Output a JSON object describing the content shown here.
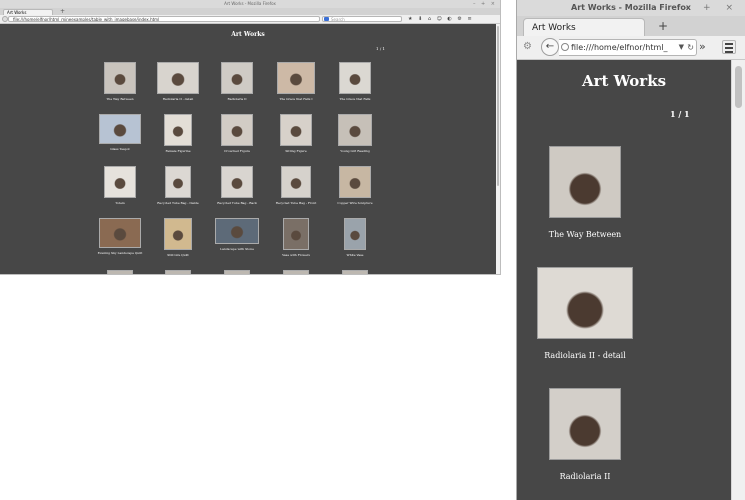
{
  "left_browser": {
    "title": "Art Works - Mozilla Firefox",
    "tab_label": "Art Works",
    "url": "file:///home/elfnor/html_mineexamples/table_with_imagebase/index.html",
    "search_placeholder": "Search",
    "page_title": "Art Works",
    "page_count": "1 / 1",
    "gallery": [
      {
        "caption": "The Way Between",
        "tone": "#c9c4bd"
      },
      {
        "caption": "Radiolaria II - detail",
        "tone": "#d8d4ce"
      },
      {
        "caption": "Radiolaria II",
        "tone": "#cfcbc5"
      },
      {
        "caption": "The Grace that Falls I",
        "tone": "#cdb9a6"
      },
      {
        "caption": "The Grace that Falls",
        "tone": "#dbd8d2"
      },
      {
        "caption": "Glass Teapot",
        "tone": "#b7c3d3"
      },
      {
        "caption": "Female Figurine",
        "tone": "#e3ded6"
      },
      {
        "caption": "Crouched Figure",
        "tone": "#d2ccc5"
      },
      {
        "caption": "Sitting Figure",
        "tone": "#d7d1ca"
      },
      {
        "caption": "Young Girl Reading",
        "tone": "#c6c0b8"
      },
      {
        "caption": "Totem",
        "tone": "#e6e2dc"
      },
      {
        "caption": "Recycled Tube Bag - Inside",
        "tone": "#dcd8d3"
      },
      {
        "caption": "Recycled Tube Bag - Back",
        "tone": "#d9d5d0"
      },
      {
        "caption": "Recycled Tube Bag - Front",
        "tone": "#d6d2cc"
      },
      {
        "caption": "Copper Wire Sculpture",
        "tone": "#c7b7a3"
      },
      {
        "caption": "Evening Sky Landscape Quilt",
        "tone": "#8a6a52"
      },
      {
        "caption": "Still Life Quilt",
        "tone": "#d1b98f"
      },
      {
        "caption": "Landscape with Stone",
        "tone": "#5d6a78"
      },
      {
        "caption": "Vase with Flowers",
        "tone": "#7a6f66"
      },
      {
        "caption": "White Vase",
        "tone": "#9aa3ab"
      }
    ]
  },
  "right_browser": {
    "title": "Art Works - Mozilla Firefox",
    "tab_label": "Art Works",
    "new_tab": "+",
    "url": "file:///home/elfnor/html_",
    "page_title": "Art Works",
    "page_count": "1 / 1",
    "items": [
      {
        "caption": "The Way Between",
        "tone": "#cfcac3"
      },
      {
        "caption": "Radiolaria II - detail",
        "tone": "#dedad4"
      },
      {
        "caption": "Radiolaria II",
        "tone": "#d3cfc9"
      }
    ]
  },
  "icons": {
    "back": "arrow-left-icon",
    "reload": "reload-icon",
    "menu": "hamburger-menu-icon",
    "overflow": "chevron-double-right-icon",
    "page": "globe-icon"
  }
}
